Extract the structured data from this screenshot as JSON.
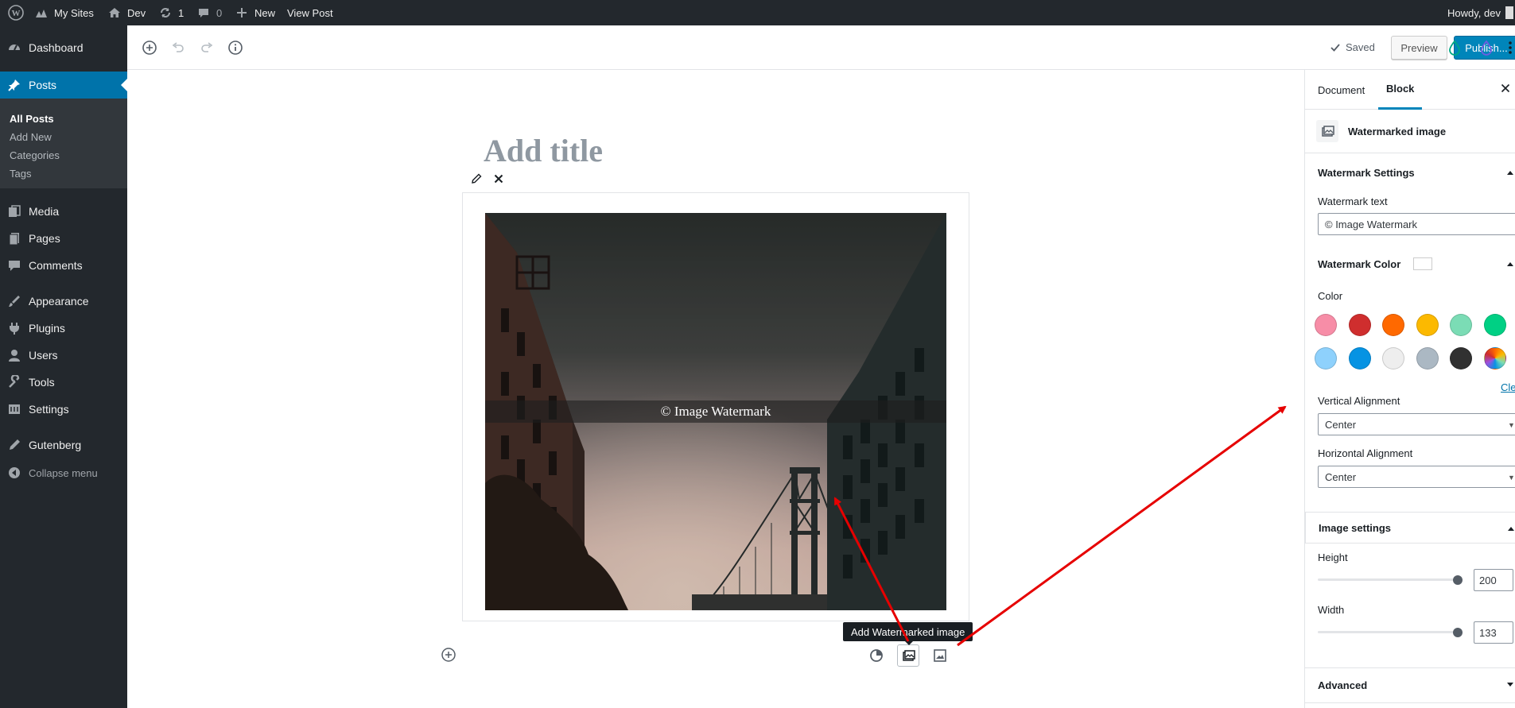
{
  "adminbar": {
    "my_sites": "My Sites",
    "site_name": "Dev",
    "updates_count": "1",
    "comments_count": "0",
    "new_label": "New",
    "view_post": "View Post",
    "howdy": "Howdy, dev"
  },
  "sidebar": {
    "items": [
      {
        "label": "Dashboard",
        "icon": "dashboard-icon"
      },
      {
        "label": "Posts",
        "icon": "pin-icon"
      },
      {
        "label": "Media",
        "icon": "media-icon"
      },
      {
        "label": "Pages",
        "icon": "pages-icon"
      },
      {
        "label": "Comments",
        "icon": "comments-icon"
      },
      {
        "label": "Appearance",
        "icon": "appearance-icon"
      },
      {
        "label": "Plugins",
        "icon": "plugins-icon"
      },
      {
        "label": "Users",
        "icon": "users-icon"
      },
      {
        "label": "Tools",
        "icon": "tools-icon"
      },
      {
        "label": "Settings",
        "icon": "settings-icon"
      },
      {
        "label": "Gutenberg",
        "icon": "gutenberg-icon"
      }
    ],
    "submenu": [
      "All Posts",
      "Add New",
      "Categories",
      "Tags"
    ],
    "collapse": "Collapse menu"
  },
  "header": {
    "saved": "Saved",
    "preview": "Preview",
    "publish": "Publish..."
  },
  "editor": {
    "title_placeholder": "Add title",
    "watermark_text": "© Image Watermark",
    "tooltip": "Add Watermarked image"
  },
  "settings_sidebar": {
    "tabs": [
      "Document",
      "Block"
    ],
    "block_name": "Watermarked image",
    "watermark_settings": "Watermark Settings",
    "watermark_text_label": "Watermark text",
    "watermark_text_value": "© Image Watermark",
    "watermark_color": "Watermark Color",
    "color_label": "Color",
    "swatches": [
      "#f78da7",
      "#cf2e2e",
      "#ff6900",
      "#fcb900",
      "#7bdcb5",
      "#00d084",
      "#8ed1fc",
      "#0693e3",
      "#eeeeee",
      "#abb8c3",
      "#313131",
      "gradient"
    ],
    "clear": "Cle",
    "vertical_alignment_label": "Vertical Alignment",
    "vertical_alignment_value": "Center",
    "horizontal_alignment_label": "Horizontal Alignment",
    "horizontal_alignment_value": "Center",
    "image_settings": "Image settings",
    "height_label": "Height",
    "height_value": "200",
    "height_level": 1.0,
    "width_label": "Width",
    "width_value": "133",
    "width_level": 1.0,
    "advanced": "Advanced"
  },
  "colors": {
    "accent": "#0085ba",
    "admin_dark": "#23282d",
    "current_menu": "#0073aa",
    "annotation_arrow": "#e60000"
  }
}
